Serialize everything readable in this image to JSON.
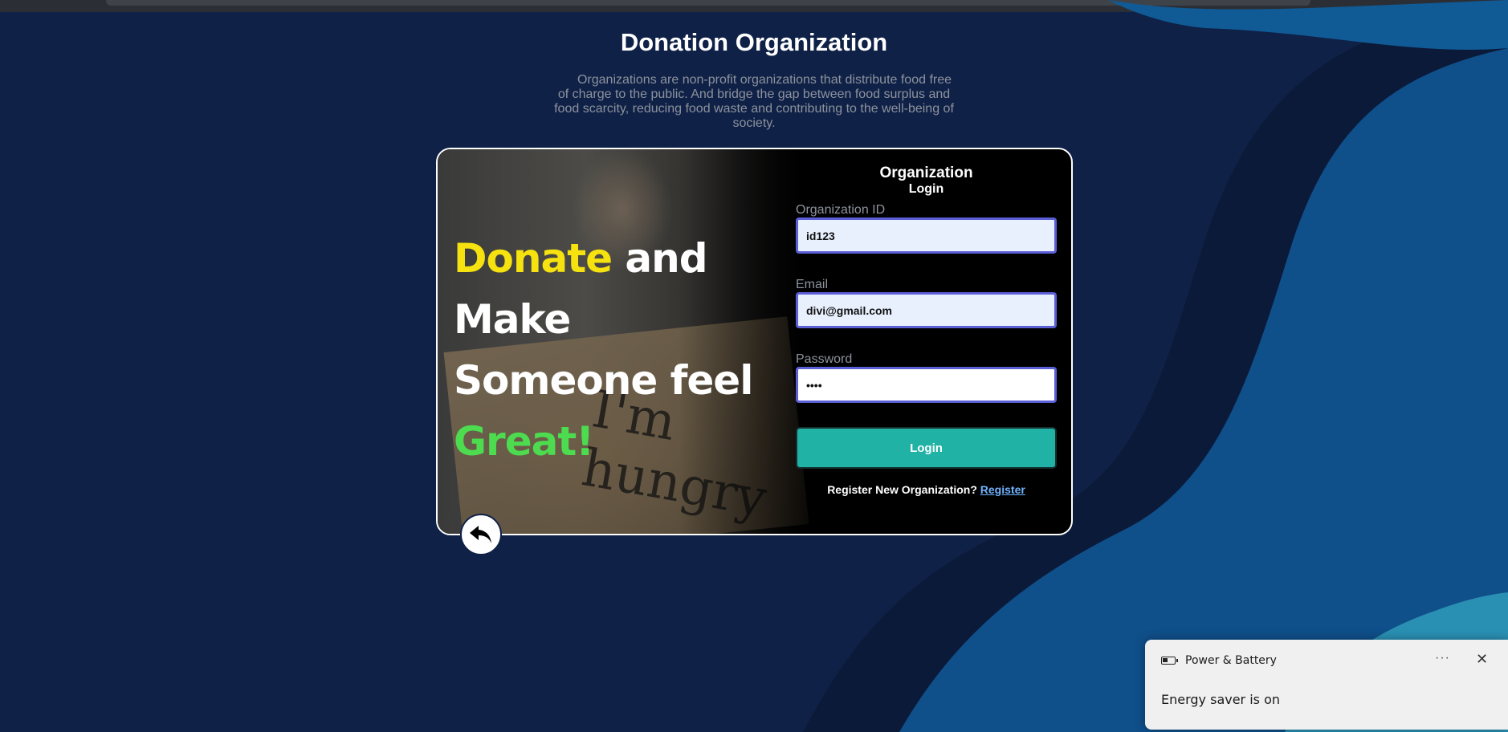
{
  "page": {
    "title": "Donation Organization",
    "description": "Organizations are non-profit organizations that distribute food free of charge to the public. And bridge the gap between food surplus and food scarcity, reducing food waste and contributing to the well-being of society."
  },
  "hero": {
    "word1": "Donate",
    "word2": " and",
    "line2": "Make",
    "line3": "Someone feel",
    "line4": "Great!",
    "sign_text": "I'm hungry"
  },
  "login_form": {
    "title": "Organization",
    "subtitle": "Login",
    "org_id_label": "Organization ID",
    "org_id_value": "id123",
    "email_label": "Email",
    "email_value": "divi@gmail.com",
    "password_label": "Password",
    "password_value": "••••",
    "login_button": "Login",
    "register_prompt": "Register New Organization?",
    "register_link": "Register"
  },
  "back_button": {
    "icon": "undo-arrow-icon"
  },
  "notification": {
    "app": "Power & Battery",
    "message": "Energy saver is on",
    "more": "···",
    "close": "✕"
  },
  "colors": {
    "background": "#0f2147",
    "accent_yellow": "#f5e20f",
    "accent_green": "#4ddb4f",
    "login_button": "#20b2a5",
    "input_border": "#5b5fd6"
  }
}
